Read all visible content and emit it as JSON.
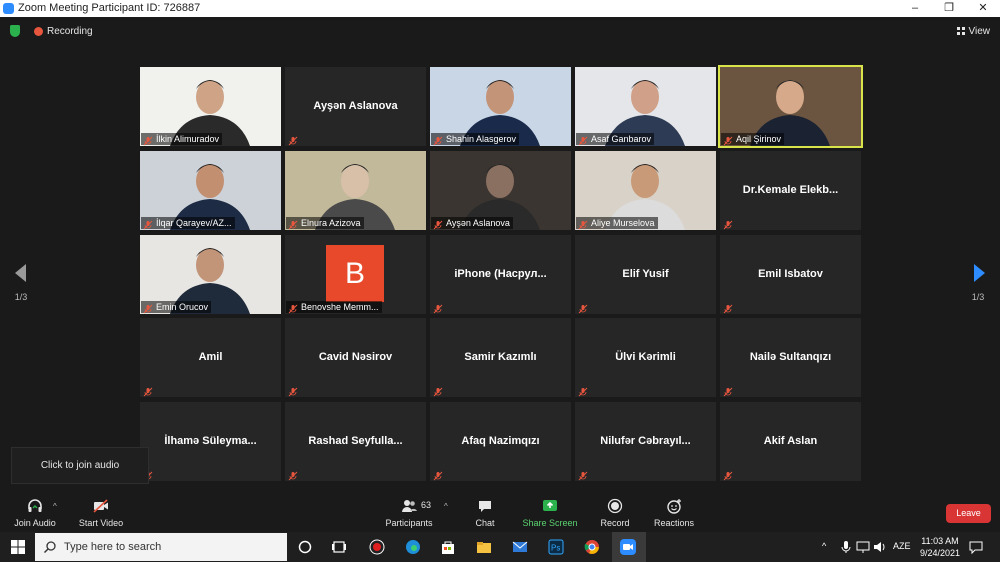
{
  "window": {
    "title": "Zoom Meeting Participant ID: 726887",
    "minimize": "–",
    "maximize": "❐",
    "close": "✕"
  },
  "topbar": {
    "recording_label": "Recording",
    "view_label": "View"
  },
  "pager": {
    "left": "1/3",
    "right": "1/3"
  },
  "tiles": [
    {
      "name": "İlkin Alimuradov",
      "video": true
    },
    {
      "name": "Ayşən Aslanova",
      "video": false
    },
    {
      "name": "Shahin Alasgerov",
      "video": true
    },
    {
      "name": "Asaf Ganbarov",
      "video": true
    },
    {
      "name": "Aqil Şirinov",
      "video": true,
      "active": true
    },
    {
      "name": "İlqar Qarayev/AZ...",
      "video": true
    },
    {
      "name": "Elnura Azizova",
      "video": true
    },
    {
      "name": "Ayşən Aslanova",
      "video": true
    },
    {
      "name": "Aliye Murselova",
      "video": true
    },
    {
      "name": "Dr.Kemale  Elekb...",
      "video": false
    },
    {
      "name": "Emin Orucov",
      "video": true
    },
    {
      "name": "Benovshe Memm...",
      "video": false,
      "avatar": "B"
    },
    {
      "name": "iPhone  (Насрул...",
      "video": false
    },
    {
      "name": "Elif Yusif",
      "video": false
    },
    {
      "name": "Emil Isbatov",
      "video": false
    },
    {
      "name": "Amil",
      "video": false
    },
    {
      "name": "Cavid Nəsirov",
      "video": false
    },
    {
      "name": "Samir Kazımlı",
      "video": false
    },
    {
      "name": "Ülvi Kərimli",
      "video": false
    },
    {
      "name": "Nailə Sultanqızı",
      "video": false
    },
    {
      "name": "İlhamə  Süleyma...",
      "video": false
    },
    {
      "name": "Rashad  Seyfulla...",
      "video": false
    },
    {
      "name": "Afaq Nazimqızı",
      "video": false
    },
    {
      "name": "Nilufər  Cəbrayıl...",
      "video": false
    },
    {
      "name": "Akif Aslan",
      "video": false
    }
  ],
  "tooltip": "Click to join audio",
  "controls": {
    "join_audio": "Join Audio",
    "start_video": "Start Video",
    "participants": "Participants",
    "participants_count": "63",
    "chat": "Chat",
    "share_screen": "Share Screen",
    "record": "Record",
    "reactions": "Reactions",
    "leave": "Leave"
  },
  "taskbar": {
    "search_placeholder": "Type here to search",
    "language": "AZE",
    "time": "11:03 AM",
    "date": "9/24/2021"
  },
  "colors": {
    "accent": "#2d8cff",
    "leave": "#d93535",
    "share": "#2bb24c",
    "active_speaker": "#d8e44a",
    "muted": "#e8563e"
  }
}
